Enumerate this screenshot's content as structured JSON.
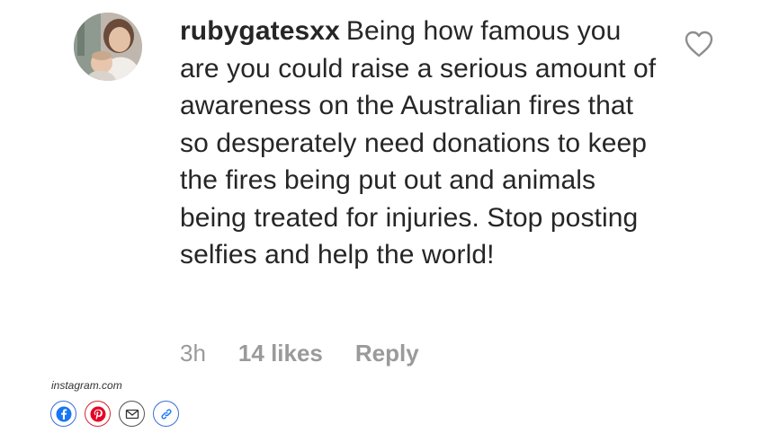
{
  "comment": {
    "username": "rubygatesxx",
    "text": "Being how famous you are you could raise a serious amount of awareness on the Australian fires that so desperately need donations to keep the fires being put out and animals being treated for injuries. Stop posting selfies and help the world!",
    "time": "3h",
    "likes": "14 likes",
    "reply_label": "Reply",
    "avatar_icon": "user-photo-avatar",
    "like_icon": "heart-outline-icon"
  },
  "source": {
    "label": "instagram.com"
  },
  "share": {
    "buttons": [
      {
        "name": "facebook",
        "icon": "facebook-icon",
        "color": "#1877f2"
      },
      {
        "name": "pinterest",
        "icon": "pinterest-icon",
        "color": "#e60023"
      },
      {
        "name": "email",
        "icon": "email-icon",
        "color": "#333333"
      },
      {
        "name": "link",
        "icon": "link-icon",
        "color": "#1877f2"
      }
    ]
  },
  "colors": {
    "text": "#262626",
    "meta": "#9a9a9a"
  }
}
